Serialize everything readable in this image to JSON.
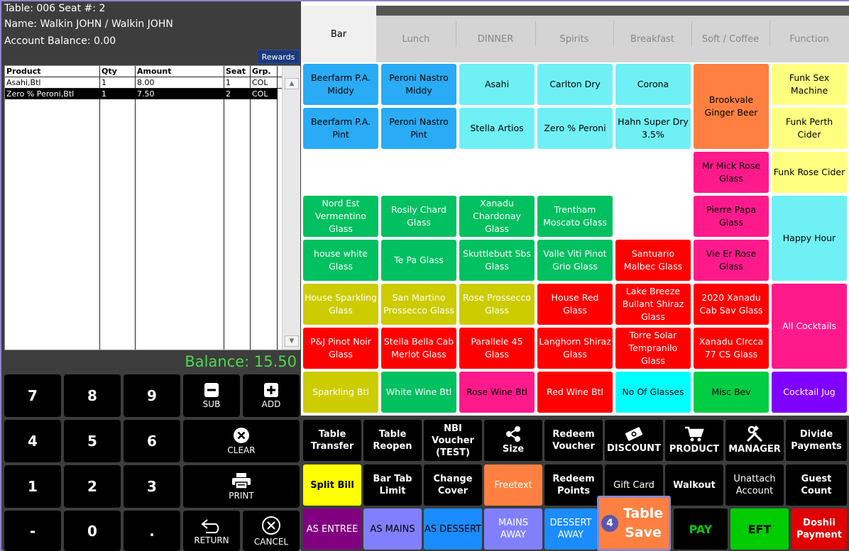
{
  "header": {
    "table_line": "Table: 006  Seat #: 2",
    "name_line": "Name: Walkin JOHN / Walkin  JOHN",
    "balance_line": "Account Balance: 0.00",
    "rewards": "Rewards"
  },
  "order": {
    "columns": [
      "Product",
      "Qty",
      "Amount",
      "Seat",
      "Grp."
    ],
    "rows": [
      {
        "product": "Asahi,Btl",
        "qty": "1",
        "amount": "8.00",
        "seat": "1",
        "grp": "COL",
        "selected": false
      },
      {
        "product": "Zero % Peroni,Btl",
        "qty": "1",
        "amount": "7.50",
        "seat": "2",
        "grp": "COL",
        "selected": true
      }
    ],
    "balance": "Balance: 15.50"
  },
  "keypad": {
    "k7": "7",
    "k8": "8",
    "k9": "9",
    "sub": "SUB",
    "add": "ADD",
    "k4": "4",
    "k5": "5",
    "k6": "6",
    "clear": "CLEAR",
    "k1": "1",
    "k2": "2",
    "k3": "3",
    "print": "PRINT",
    "minus": "-",
    "k0": "0",
    "dot": ".",
    "return": "RETURN",
    "cancel": "CANCEL",
    "icons": {
      "sub": "minus-box-icon",
      "add": "plus-box-icon",
      "clear": "x-circle-icon",
      "print": "printer-icon",
      "return": "return-arrow-icon",
      "cancel": "x-circle-outline-icon"
    }
  },
  "tabs": [
    "Bar",
    "Lunch",
    "DINNER",
    "Spirits",
    "Breakfast",
    "Soft / Coffee",
    "Function"
  ],
  "products": {
    "beerfarm_middy": "Beerfarm P.A. Middy",
    "peroni_middy": "Peroni Nastro Middy",
    "asahi": "Asahi",
    "carlton": "Carlton Dry",
    "corona": "Corona",
    "brookvale": "Brookvale Ginger Beer",
    "funk_sex": "Funk Sex Machine",
    "beerfarm_pint": "Beerfarm P.A. Pint",
    "peroni_pint": "Peroni Nastro Pint",
    "stella": "Stella Artios",
    "zero_peroni": "Zero % Peroni",
    "hahn": "Hahn Super Dry 3.5%",
    "funk_perth": "Funk Perth Cider",
    "mr_mick": "Mr Mick Rose Glass",
    "funk_rose": "Funk Rose Cider",
    "nord_est": "Nord Est Vermentino Glass",
    "rosily": "Rosily Chard Glass",
    "xanadu_chard": "Xanadu Chardonay Glass",
    "trentham": "Trentham Moscato Glass",
    "pierre_papa": "Pierre Papa Glass",
    "happy_hour": "Happy Hour",
    "house_white": "house white Glass",
    "te_pa": "Te Pa Glass",
    "skuttlebutt": "Skuttlebutt Sbs Glass",
    "valle_viti": "Valle Viti Pinot Grio Glass",
    "santuario": "Santuario Malbec Glass",
    "vie_er": "Vie Er Rose Glass",
    "house_sparkling": "House Sparkling Glass",
    "san_martino": "San Martino Prossecco Glass",
    "rose_prossecco": "Rose Prossecco Glass",
    "house_red": "House Red Glass",
    "lake_breeze": "Lake Breeze Bullant Shiraz Glass",
    "xanadu_cab": "2020 Xanadu Cab Sav Glass",
    "all_cocktails": "All Cocktails",
    "pj_pinot": "P&J Pinot Noir Glass",
    "stella_bella": "Stella Bella Cab Merlot Glass",
    "parallele": "Parallele 45 Glass",
    "langhorn": "Langhorn Shiraz Glass",
    "torre_solar": "Torre Solar Tempranilo Glass",
    "xanadu_circca": "Xanadu CIrcca 77 CS Glass",
    "sparkling_btl": "Sparkling Btl",
    "white_wine_btl": "White Wine Btl",
    "rose_wine_btl": "Rose Wine Btl",
    "red_wine_btl": "Red Wine Btl",
    "no_glasses": "No Of Glasses",
    "misc_bev": "Misc Bev",
    "cocktail_jug": "Cocktail Jug"
  },
  "functions": {
    "table_transfer": "Table Transfer",
    "table_reopen": "Table Reopen",
    "nbi_voucher": "NBI Voucher (TEST)",
    "size": "Size",
    "redeem_voucher": "Redeem Voucher",
    "discount": "DISCOUNT",
    "product": "PRODUCT",
    "manager": "MANAGER",
    "divide_payments": "Divide Payments",
    "split_bill": "Split Bill",
    "bar_tab_limit": "Bar Tab Limit",
    "change_cover": "Change Cover",
    "freetext": "Freetext",
    "redeem_points": "Redeem Points",
    "gift_card": "Gift Card",
    "walkout": "Walkout",
    "unattach_account": "Unattach Account",
    "guest_count": "Guest Count",
    "as_entree": "AS ENTREE",
    "as_mains": "AS MAINS",
    "as_dessert": "AS DESSERT",
    "mains_away": "MAINS AWAY",
    "dessert_away": "DESSERT AWAY",
    "table_save_badge": "4",
    "table_save": "Table Save",
    "pay": "PAY",
    "eft": "EFT",
    "doshii_payment": "Doshii Payment",
    "icons": {
      "size": "share-icon",
      "discount": "money-icon",
      "product": "cart-icon",
      "manager": "tools-icon"
    }
  },
  "colors": {
    "blue": "#29abf5",
    "cyan": "#6ff0f5",
    "orange": "#ff8040",
    "yellow": "#ffff80",
    "pink": "#ff1a8c",
    "green": "#00c060",
    "olive": "#cccc00",
    "red": "#ff0000",
    "purple": "#8000ff",
    "magenta_fn": "#800080",
    "lavender": "#8080ff",
    "azure": "#1a8cff",
    "pay_green": "#00cc00",
    "eft_green": "#00cc00",
    "doshii_red": "#e00000",
    "balance_green": "#4cd94c"
  }
}
